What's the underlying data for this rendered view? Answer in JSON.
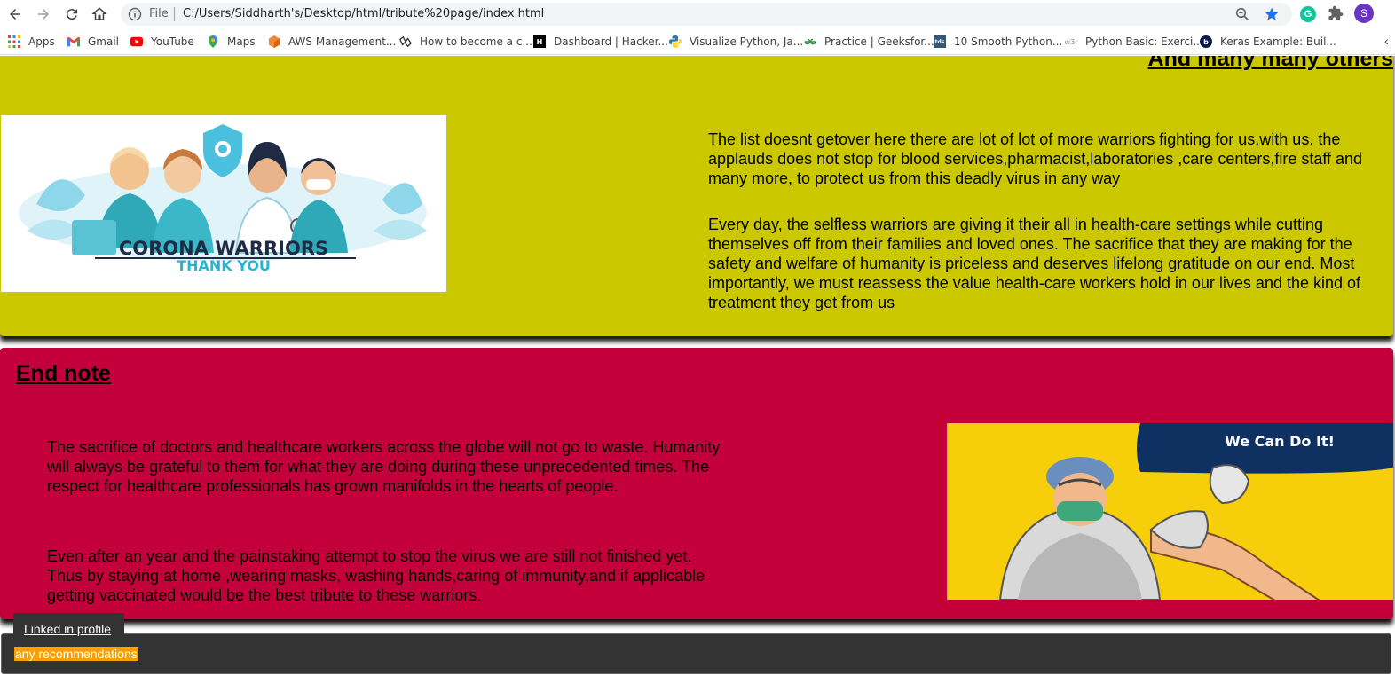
{
  "browser": {
    "address_scheme_label": "File",
    "url": "C:/Users/Siddharth's/Desktop/html/tribute%20page/index.html",
    "profile_initial": "S",
    "extension_initial": "G"
  },
  "bookmarks": [
    {
      "label": "Apps",
      "icon": "apps-grid-icon"
    },
    {
      "label": "Gmail",
      "icon": "gmail-icon"
    },
    {
      "label": "YouTube",
      "icon": "youtube-icon"
    },
    {
      "label": "Maps",
      "icon": "maps-icon"
    },
    {
      "label": "AWS Management...",
      "icon": "aws-icon"
    },
    {
      "label": "How to become a c...",
      "icon": "wave-icon"
    },
    {
      "label": "Dashboard | Hacker...",
      "icon": "hackerrank-icon"
    },
    {
      "label": "Visualize Python, Ja...",
      "icon": "python-icon"
    },
    {
      "label": "Practice | Geeksfor...",
      "icon": "gfg-icon"
    },
    {
      "label": "10 Smooth Python...",
      "icon": "tds-icon"
    },
    {
      "label": "Python Basic: Exerci...",
      "icon": "w3r-icon"
    },
    {
      "label": "Keras Example: Buil...",
      "icon": "b-icon"
    }
  ],
  "bookmark_icon_text": {
    "hackerrank": "H",
    "tds": "tds",
    "w3r": "w3r",
    "b": "b"
  },
  "yellow_section": {
    "heading": "And many many others",
    "image_title": "CORONA WARRIORS",
    "image_subtitle": "THANK YOU",
    "paragraphs": [
      "The list doesnt getover here there are lot of lot of more warriors fighting for us,with us. the applauds does not stop for blood services,pharmacist,laboratories ,care centers,fire staff and many more, to protect us from this deadly virus in any way",
      "Every day, the selfless warriors are giving it their all in health-care settings while cutting themselves off from their families and loved ones. The sacrifice that they are making for the safety and welfare of humanity is priceless and deserves lifelong gratitude on our end. Most importantly, we must reassess the value health-care workers hold in our lives and the kind of treatment they get from us"
    ]
  },
  "red_section": {
    "heading": "End note",
    "paragraphs": [
      "The sacrifice of doctors and healthcare workers across the globe will not go to waste. Humanity will always be grateful to them for what they are doing during these unprecedented times. The respect for healthcare professionals has grown manifolds in the hearts of people.",
      "Even after an year and the painstaking attempt to stop the virus we are still not finished yet. Thus by staying at home ,wearing masks, washing hands,caring of immunity,and if applicable getting vaccinated would be the best tribute to these warriors."
    ],
    "image_text": "We Can Do It!"
  },
  "footer": {
    "linkedin_label": "Linked in profile",
    "recommendations_text": "any recommendations"
  },
  "colors": {
    "yellow_section": "#cbc800",
    "red_section": "#c3003a",
    "footer": "#333333",
    "highlight": "#f5a000"
  }
}
